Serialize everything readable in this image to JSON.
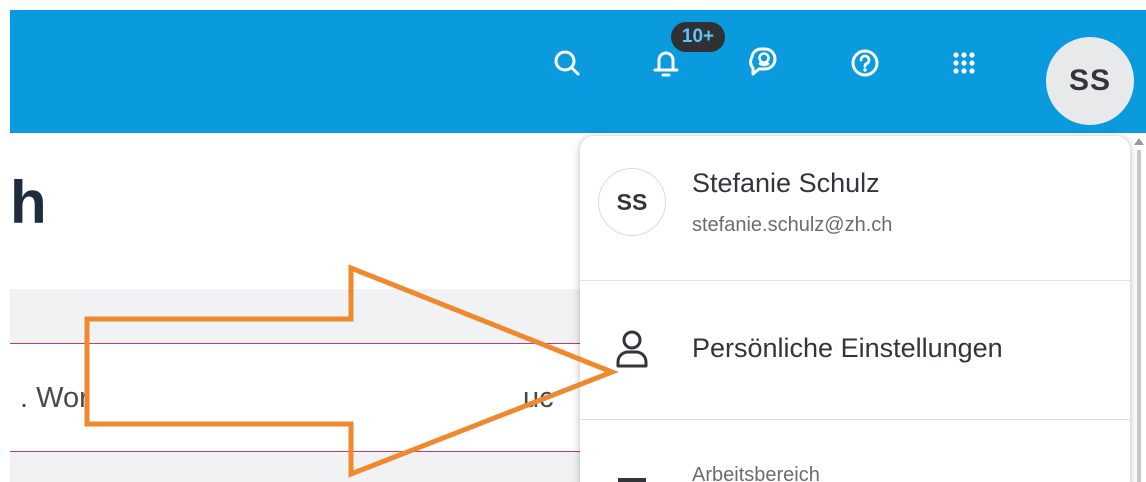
{
  "header": {
    "notification_badge": "10+",
    "avatar_initials": "SS",
    "icons": [
      "search-icon",
      "bell-icon",
      "chat-icon",
      "help-icon",
      "app-grid-icon"
    ]
  },
  "page": {
    "title": "h",
    "row_text_left": ". Wor",
    "row_text_right": "uc"
  },
  "user_menu": {
    "avatar_initials": "SS",
    "name": "Stefanie Schulz",
    "email": "stefanie.schulz@zh.ch",
    "items": [
      {
        "icon": "person-icon",
        "label": "Persönliche Einstellungen"
      },
      {
        "icon": "workspace-icon",
        "label": "Arbeitsbereich"
      }
    ]
  },
  "colors": {
    "shellbar": "#0a9ade",
    "badge_bg": "#2f3133",
    "badge_text": "#5ec3ff",
    "annotation_arrow": "#f0892d",
    "row_line": "#c7347a"
  }
}
